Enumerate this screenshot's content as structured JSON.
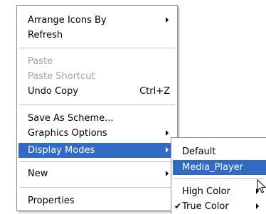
{
  "context_menu": {
    "items": [
      {
        "label": "Arrange Icons By"
      },
      {
        "label": "Refresh"
      },
      {
        "label": "Paste"
      },
      {
        "label": "Paste Shortcut"
      },
      {
        "label": "Undo Copy",
        "shortcut": "Ctrl+Z"
      },
      {
        "label": "Save As Scheme..."
      },
      {
        "label": "Graphics Options"
      },
      {
        "label": "Display Modes"
      },
      {
        "label": "New"
      },
      {
        "label": "Properties"
      }
    ]
  },
  "submenu": {
    "items": [
      {
        "label": "Default"
      },
      {
        "label": "Media_Player"
      },
      {
        "label": "High Color"
      },
      {
        "label": "True Color",
        "check": "✔"
      }
    ]
  },
  "colors": {
    "highlight": "#316ac5",
    "disabled_text": "#a3a3a3"
  }
}
